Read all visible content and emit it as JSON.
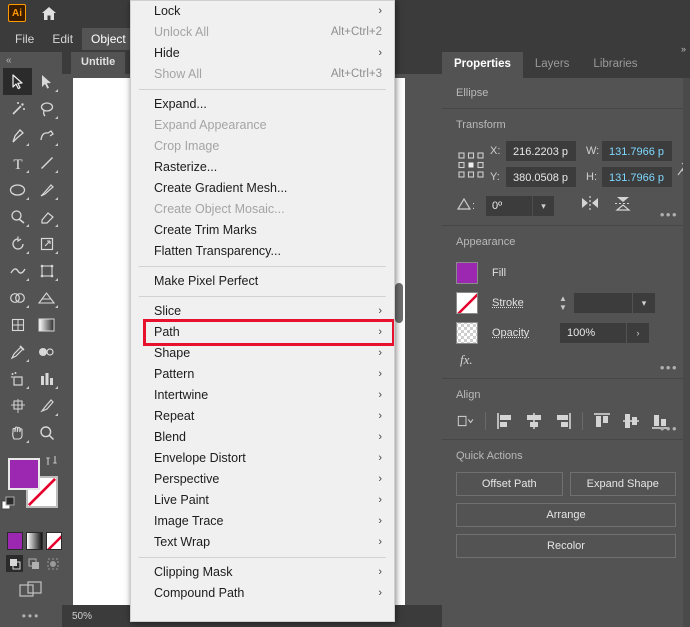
{
  "app": {
    "logo_text": "Ai",
    "zoom_level": "50%"
  },
  "menubar": {
    "items": [
      {
        "label": "File",
        "active": false
      },
      {
        "label": "Edit",
        "active": false
      },
      {
        "label": "Object",
        "active": true
      }
    ]
  },
  "document": {
    "tab_title": "Untitle"
  },
  "context_menu": {
    "highlighted_item": "Path",
    "highlight_color": "#e8112d",
    "items": [
      {
        "label": "Lock",
        "submenu": true,
        "disabled": false,
        "shortcut": ""
      },
      {
        "label": "Unlock All",
        "submenu": false,
        "disabled": true,
        "shortcut": "Alt+Ctrl+2"
      },
      {
        "label": "Hide",
        "submenu": true,
        "disabled": false,
        "shortcut": ""
      },
      {
        "label": "Show All",
        "submenu": false,
        "disabled": true,
        "shortcut": "Alt+Ctrl+3"
      },
      {
        "separator": true
      },
      {
        "label": "Expand...",
        "submenu": false,
        "disabled": false,
        "shortcut": ""
      },
      {
        "label": "Expand Appearance",
        "submenu": false,
        "disabled": true,
        "shortcut": ""
      },
      {
        "label": "Crop Image",
        "submenu": false,
        "disabled": true,
        "shortcut": ""
      },
      {
        "label": "Rasterize...",
        "submenu": false,
        "disabled": false,
        "shortcut": ""
      },
      {
        "label": "Create Gradient Mesh...",
        "submenu": false,
        "disabled": false,
        "shortcut": ""
      },
      {
        "label": "Create Object Mosaic...",
        "submenu": false,
        "disabled": true,
        "shortcut": ""
      },
      {
        "label": "Create Trim Marks",
        "submenu": false,
        "disabled": false,
        "shortcut": ""
      },
      {
        "label": "Flatten Transparency...",
        "submenu": false,
        "disabled": false,
        "shortcut": ""
      },
      {
        "separator": true
      },
      {
        "label": "Make Pixel Perfect",
        "submenu": false,
        "disabled": false,
        "shortcut": ""
      },
      {
        "separator": true
      },
      {
        "label": "Slice",
        "submenu": true,
        "disabled": false,
        "shortcut": ""
      },
      {
        "label": "Path",
        "submenu": true,
        "disabled": false,
        "shortcut": ""
      },
      {
        "label": "Shape",
        "submenu": true,
        "disabled": false,
        "shortcut": ""
      },
      {
        "label": "Pattern",
        "submenu": true,
        "disabled": false,
        "shortcut": ""
      },
      {
        "label": "Intertwine",
        "submenu": true,
        "disabled": false,
        "shortcut": ""
      },
      {
        "label": "Repeat",
        "submenu": true,
        "disabled": false,
        "shortcut": ""
      },
      {
        "label": "Blend",
        "submenu": true,
        "disabled": false,
        "shortcut": ""
      },
      {
        "label": "Envelope Distort",
        "submenu": true,
        "disabled": false,
        "shortcut": ""
      },
      {
        "label": "Perspective",
        "submenu": true,
        "disabled": false,
        "shortcut": ""
      },
      {
        "label": "Live Paint",
        "submenu": true,
        "disabled": false,
        "shortcut": ""
      },
      {
        "label": "Image Trace",
        "submenu": true,
        "disabled": false,
        "shortcut": ""
      },
      {
        "label": "Text Wrap",
        "submenu": true,
        "disabled": false,
        "shortcut": ""
      },
      {
        "separator": true
      },
      {
        "label": "Clipping Mask",
        "submenu": true,
        "disabled": false,
        "shortcut": ""
      },
      {
        "label": "Compound Path",
        "submenu": true,
        "disabled": false,
        "shortcut": ""
      }
    ]
  },
  "properties_panel": {
    "tabs": [
      {
        "label": "Properties",
        "active": true
      },
      {
        "label": "Layers",
        "active": false
      },
      {
        "label": "Libraries",
        "active": false
      }
    ],
    "object_type": "Ellipse",
    "transform": {
      "title": "Transform",
      "x_label": "X:",
      "x_value": "216.2203 p",
      "y_label": "Y:",
      "y_value": "380.0508 p",
      "w_label": "W:",
      "w_value": "131.7966 p",
      "h_label": "H:",
      "h_value": "131.7966 p",
      "angle_value": "0º",
      "value_accent": "#7fd8ff"
    },
    "appearance": {
      "title": "Appearance",
      "fill_label": "Fill",
      "fill_color": "#9c27b0",
      "stroke_label": "Stroke",
      "stroke_value": "",
      "opacity_label": "Opacity",
      "opacity_value": "100%",
      "fx_label": "fx."
    },
    "align": {
      "title": "Align"
    },
    "quick_actions": {
      "title": "Quick Actions",
      "offset_path": "Offset Path",
      "expand_shape": "Expand Shape",
      "arrange": "Arrange",
      "recolor": "Recolor"
    }
  },
  "toolbar": {
    "collapse_label": "«",
    "fill_color": "#9c27b0",
    "stroke_color": "#ffffff"
  },
  "window_controls": {
    "minimize": "─",
    "maximize": "□",
    "close": "✕"
  }
}
